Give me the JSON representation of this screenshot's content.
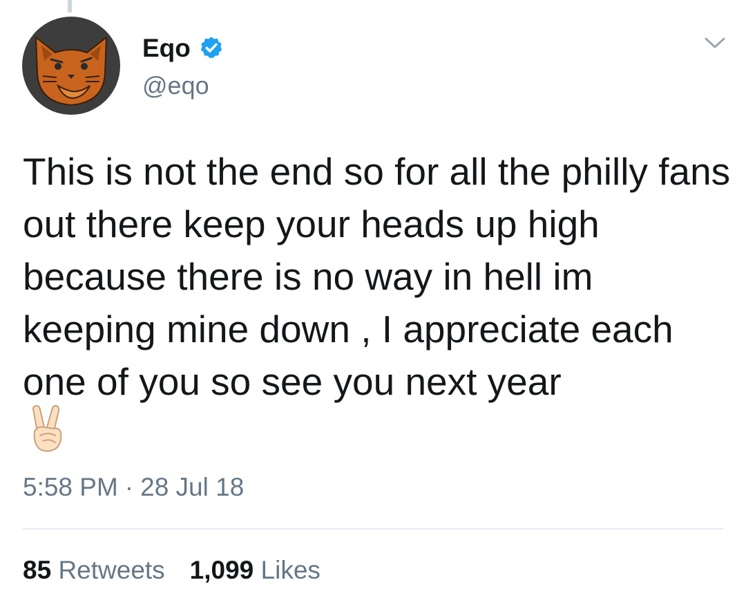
{
  "user": {
    "display_name": "Eqo",
    "handle": "@eqo",
    "verified": true,
    "avatar_icon": "cat-face-avatar",
    "verified_icon": "verified-badge-icon"
  },
  "menu": {
    "icon": "chevron-down-icon"
  },
  "tweet": {
    "text": "This is not the end so for all the philly fans out there keep your heads up high because there is no way in hell im keeping mine down , I appreciate each one of you so see you next year",
    "emoji": "✌️",
    "emoji_name": "victory-hand-emoji"
  },
  "timestamp": {
    "time": "5:58 PM",
    "separator": "·",
    "date": "28 Jul 18"
  },
  "stats": {
    "retweets_count": "85",
    "retweets_label": "Retweets",
    "likes_count": "1,099",
    "likes_label": "Likes"
  },
  "colors": {
    "text": "#14171a",
    "secondary": "#657786",
    "verified_blue": "#1da1f2",
    "divider": "#e6ecf0",
    "avatar_bg": "#3d3d3d",
    "cat_orange": "#c8641e"
  }
}
